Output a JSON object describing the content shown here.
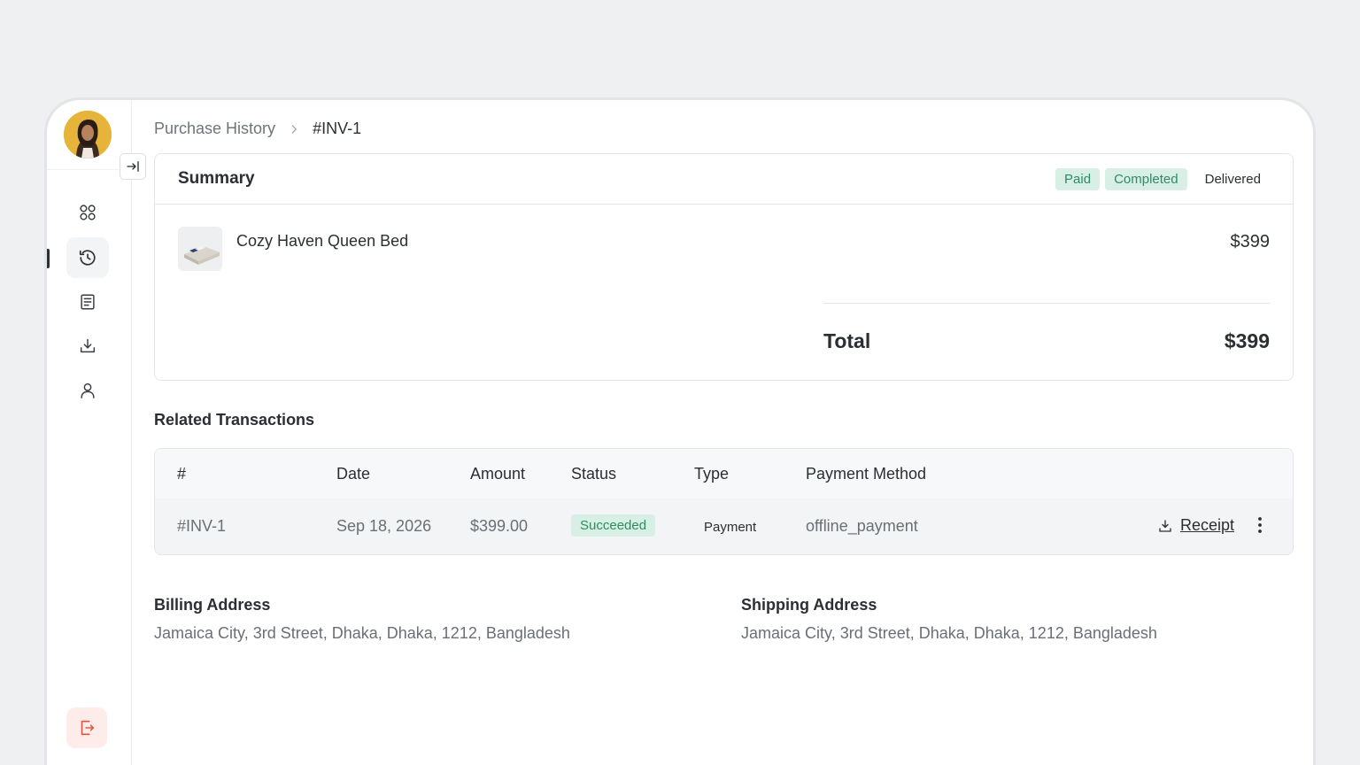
{
  "breadcrumb": {
    "parent": "Purchase History",
    "current": "#INV-1"
  },
  "summary": {
    "title": "Summary",
    "badges": [
      "Paid",
      "Completed"
    ],
    "delivery_status": "Delivered",
    "item": {
      "name": "Cozy Haven Queen Bed",
      "price": "$399",
      "thumbnail_icon": "bed-thumbnail"
    },
    "total_label": "Total",
    "total_value": "$399"
  },
  "transactions": {
    "title": "Related Transactions",
    "columns": [
      "#",
      "Date",
      "Amount",
      "Status",
      "Type",
      "Payment Method"
    ],
    "rows": [
      {
        "id": "#INV-1",
        "date": "Sep 18, 2026",
        "amount": "$399.00",
        "status": "Succeeded",
        "type": "Payment",
        "method": "offline_payment",
        "action": "Receipt"
      }
    ]
  },
  "billing": {
    "title": "Billing Address",
    "address": "Jamaica City, 3rd Street, Dhaka, Dhaka, 1212, Bangladesh"
  },
  "shipping": {
    "title": "Shipping Address",
    "address": "Jamaica City, 3rd Street, Dhaka, Dhaka, 1212, Bangladesh"
  },
  "sidebar": {
    "items": [
      "dashboard-icon",
      "history-icon",
      "document-icon",
      "download-icon",
      "user-icon"
    ],
    "active": "history-icon",
    "logout_icon": "logout-icon"
  },
  "colors": {
    "success_bg": "#d7efe5",
    "success_text": "#2f8a65",
    "logout_bg": "#fdecea",
    "logout_icon": "#e5533d"
  }
}
